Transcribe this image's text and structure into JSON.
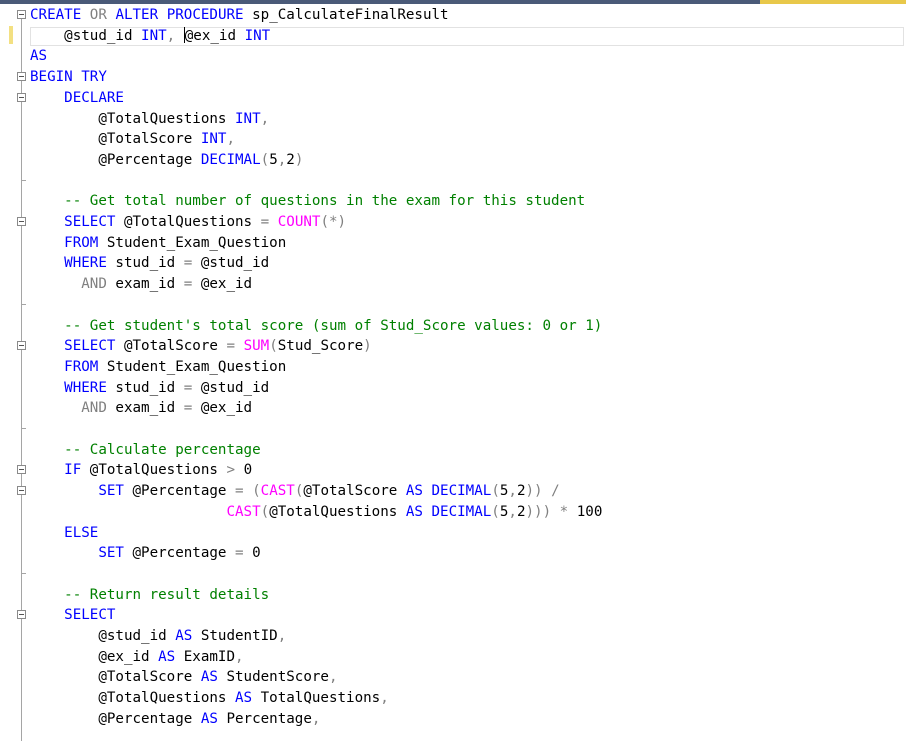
{
  "editor": {
    "lines": [
      [
        {
          "t": "CREATE",
          "c": "kw"
        },
        {
          "t": " ",
          "c": ""
        },
        {
          "t": "OR",
          "c": "gy"
        },
        {
          "t": " ",
          "c": ""
        },
        {
          "t": "ALTER",
          "c": "kw"
        },
        {
          "t": " ",
          "c": ""
        },
        {
          "t": "PROCEDURE",
          "c": "kw"
        },
        {
          "t": " sp_CalculateFinalResult",
          "c": ""
        }
      ],
      [
        {
          "t": "    @stud_id ",
          "c": ""
        },
        {
          "t": "INT",
          "c": "kw"
        },
        {
          "t": ", ",
          "c": "gy"
        },
        {
          "t": "",
          "c": "caret"
        },
        {
          "t": "@ex_id ",
          "c": ""
        },
        {
          "t": "INT",
          "c": "kw"
        }
      ],
      [
        {
          "t": "AS",
          "c": "kw"
        }
      ],
      [
        {
          "t": "BEGIN",
          "c": "kw"
        },
        {
          "t": " ",
          "c": ""
        },
        {
          "t": "TRY",
          "c": "kw"
        }
      ],
      [
        {
          "t": "    ",
          "c": ""
        },
        {
          "t": "DECLARE",
          "c": "kw"
        }
      ],
      [
        {
          "t": "        @TotalQuestions ",
          "c": ""
        },
        {
          "t": "INT",
          "c": "kw"
        },
        {
          "t": ",",
          "c": "gy"
        }
      ],
      [
        {
          "t": "        @TotalScore ",
          "c": ""
        },
        {
          "t": "INT",
          "c": "kw"
        },
        {
          "t": ",",
          "c": "gy"
        }
      ],
      [
        {
          "t": "        @Percentage ",
          "c": ""
        },
        {
          "t": "DECIMAL",
          "c": "kw"
        },
        {
          "t": "(",
          "c": "gy"
        },
        {
          "t": "5",
          "c": ""
        },
        {
          "t": ",",
          "c": "gy"
        },
        {
          "t": "2",
          "c": ""
        },
        {
          "t": ")",
          "c": "gy"
        }
      ],
      [
        {
          "t": "",
          "c": ""
        }
      ],
      [
        {
          "t": "    -- Get total number of questions in the exam for this student",
          "c": "cm"
        }
      ],
      [
        {
          "t": "    ",
          "c": ""
        },
        {
          "t": "SELECT",
          "c": "kw"
        },
        {
          "t": " @TotalQuestions ",
          "c": ""
        },
        {
          "t": "=",
          "c": "gy"
        },
        {
          "t": " ",
          "c": ""
        },
        {
          "t": "COUNT",
          "c": "fn"
        },
        {
          "t": "(*)",
          "c": "gy"
        }
      ],
      [
        {
          "t": "    ",
          "c": ""
        },
        {
          "t": "FROM",
          "c": "kw"
        },
        {
          "t": " Student_Exam_Question",
          "c": ""
        }
      ],
      [
        {
          "t": "    ",
          "c": ""
        },
        {
          "t": "WHERE",
          "c": "kw"
        },
        {
          "t": " stud_id ",
          "c": ""
        },
        {
          "t": "=",
          "c": "gy"
        },
        {
          "t": " @stud_id",
          "c": ""
        }
      ],
      [
        {
          "t": "      ",
          "c": ""
        },
        {
          "t": "AND",
          "c": "gy"
        },
        {
          "t": " exam_id ",
          "c": ""
        },
        {
          "t": "=",
          "c": "gy"
        },
        {
          "t": " @ex_id",
          "c": ""
        }
      ],
      [
        {
          "t": "",
          "c": ""
        }
      ],
      [
        {
          "t": "    -- Get student's total score (sum of Stud_Score values: 0 or 1)",
          "c": "cm"
        }
      ],
      [
        {
          "t": "    ",
          "c": ""
        },
        {
          "t": "SELECT",
          "c": "kw"
        },
        {
          "t": " @TotalScore ",
          "c": ""
        },
        {
          "t": "=",
          "c": "gy"
        },
        {
          "t": " ",
          "c": ""
        },
        {
          "t": "SUM",
          "c": "fn"
        },
        {
          "t": "(",
          "c": "gy"
        },
        {
          "t": "Stud_Score",
          "c": ""
        },
        {
          "t": ")",
          "c": "gy"
        }
      ],
      [
        {
          "t": "    ",
          "c": ""
        },
        {
          "t": "FROM",
          "c": "kw"
        },
        {
          "t": " Student_Exam_Question",
          "c": ""
        }
      ],
      [
        {
          "t": "    ",
          "c": ""
        },
        {
          "t": "WHERE",
          "c": "kw"
        },
        {
          "t": " stud_id ",
          "c": ""
        },
        {
          "t": "=",
          "c": "gy"
        },
        {
          "t": " @stud_id",
          "c": ""
        }
      ],
      [
        {
          "t": "      ",
          "c": ""
        },
        {
          "t": "AND",
          "c": "gy"
        },
        {
          "t": " exam_id ",
          "c": ""
        },
        {
          "t": "=",
          "c": "gy"
        },
        {
          "t": " @ex_id",
          "c": ""
        }
      ],
      [
        {
          "t": "",
          "c": ""
        }
      ],
      [
        {
          "t": "    -- Calculate percentage",
          "c": "cm"
        }
      ],
      [
        {
          "t": "    ",
          "c": ""
        },
        {
          "t": "IF",
          "c": "kw"
        },
        {
          "t": " @TotalQuestions ",
          "c": ""
        },
        {
          "t": ">",
          "c": "gy"
        },
        {
          "t": " 0",
          "c": ""
        }
      ],
      [
        {
          "t": "        ",
          "c": ""
        },
        {
          "t": "SET",
          "c": "kw"
        },
        {
          "t": " @Percentage ",
          "c": ""
        },
        {
          "t": "=",
          "c": "gy"
        },
        {
          "t": " (",
          "c": "gy"
        },
        {
          "t": "CAST",
          "c": "fn"
        },
        {
          "t": "(",
          "c": "gy"
        },
        {
          "t": "@TotalScore ",
          "c": ""
        },
        {
          "t": "AS",
          "c": "kw"
        },
        {
          "t": " ",
          "c": ""
        },
        {
          "t": "DECIMAL",
          "c": "kw"
        },
        {
          "t": "(",
          "c": "gy"
        },
        {
          "t": "5",
          "c": ""
        },
        {
          "t": ",",
          "c": "gy"
        },
        {
          "t": "2",
          "c": ""
        },
        {
          "t": "))",
          "c": "gy"
        },
        {
          "t": " ",
          "c": ""
        },
        {
          "t": "/",
          "c": "gy"
        }
      ],
      [
        {
          "t": "                       ",
          "c": ""
        },
        {
          "t": "CAST",
          "c": "fn"
        },
        {
          "t": "(",
          "c": "gy"
        },
        {
          "t": "@TotalQuestions ",
          "c": ""
        },
        {
          "t": "AS",
          "c": "kw"
        },
        {
          "t": " ",
          "c": ""
        },
        {
          "t": "DECIMAL",
          "c": "kw"
        },
        {
          "t": "(",
          "c": "gy"
        },
        {
          "t": "5",
          "c": ""
        },
        {
          "t": ",",
          "c": "gy"
        },
        {
          "t": "2",
          "c": ""
        },
        {
          "t": ")))",
          "c": "gy"
        },
        {
          "t": " ",
          "c": ""
        },
        {
          "t": "*",
          "c": "gy"
        },
        {
          "t": " 100",
          "c": ""
        }
      ],
      [
        {
          "t": "    ",
          "c": ""
        },
        {
          "t": "ELSE",
          "c": "kw"
        }
      ],
      [
        {
          "t": "        ",
          "c": ""
        },
        {
          "t": "SET",
          "c": "kw"
        },
        {
          "t": " @Percentage ",
          "c": ""
        },
        {
          "t": "=",
          "c": "gy"
        },
        {
          "t": " 0",
          "c": ""
        }
      ],
      [
        {
          "t": "",
          "c": ""
        }
      ],
      [
        {
          "t": "    -- Return result details",
          "c": "cm"
        }
      ],
      [
        {
          "t": "    ",
          "c": ""
        },
        {
          "t": "SELECT",
          "c": "kw"
        }
      ],
      [
        {
          "t": "        @stud_id ",
          "c": ""
        },
        {
          "t": "AS",
          "c": "kw"
        },
        {
          "t": " StudentID",
          "c": ""
        },
        {
          "t": ",",
          "c": "gy"
        }
      ],
      [
        {
          "t": "        @ex_id ",
          "c": ""
        },
        {
          "t": "AS",
          "c": "kw"
        },
        {
          "t": " ExamID",
          "c": ""
        },
        {
          "t": ",",
          "c": "gy"
        }
      ],
      [
        {
          "t": "        @TotalScore ",
          "c": ""
        },
        {
          "t": "AS",
          "c": "kw"
        },
        {
          "t": " StudentScore",
          "c": ""
        },
        {
          "t": ",",
          "c": "gy"
        }
      ],
      [
        {
          "t": "        @TotalQuestions ",
          "c": ""
        },
        {
          "t": "AS",
          "c": "kw"
        },
        {
          "t": " TotalQuestions",
          "c": ""
        },
        {
          "t": ",",
          "c": "gy"
        }
      ],
      [
        {
          "t": "        @Percentage ",
          "c": ""
        },
        {
          "t": "AS",
          "c": "kw"
        },
        {
          "t": " Percentage",
          "c": ""
        },
        {
          "t": ",",
          "c": "gy"
        }
      ]
    ],
    "current_line_index": 1,
    "fold_markers": [
      0,
      3,
      4,
      10,
      16,
      22,
      23,
      29
    ],
    "changed_lines": [
      1
    ]
  },
  "colors": {
    "keyword": "#0000ff",
    "function": "#ff00ff",
    "comment": "#008000",
    "operator": "#808080",
    "text": "#000000",
    "change_marker": "#f3e082"
  }
}
